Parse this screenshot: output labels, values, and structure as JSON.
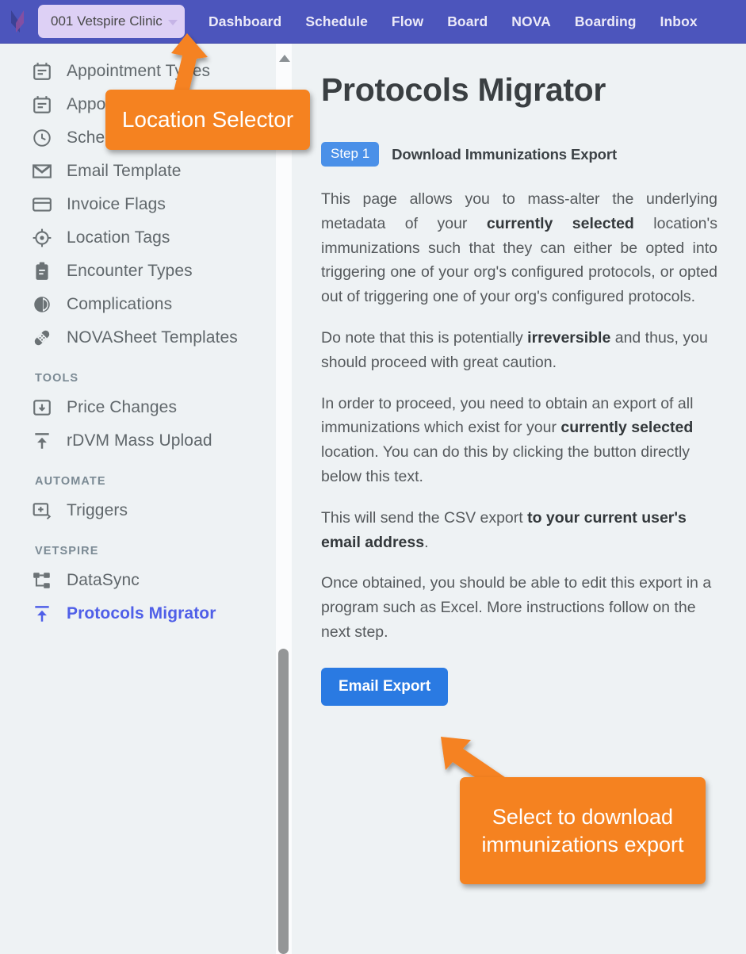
{
  "topnav": {
    "logo_icon": "vetspire-logo-icon",
    "location_selector": {
      "value": "001 Vetspire Clinic",
      "caret_icon": "chevron-down-icon"
    },
    "links": [
      {
        "label": "Dashboard"
      },
      {
        "label": "Schedule"
      },
      {
        "label": "Flow"
      },
      {
        "label": "Board"
      },
      {
        "label": "NOVA"
      },
      {
        "label": "Boarding"
      },
      {
        "label": "Inbox"
      }
    ]
  },
  "sidebar": {
    "items": [
      {
        "label": "Appointment Types",
        "icon": "calendar-icon",
        "active": false
      },
      {
        "label": "Appointment Tags",
        "icon": "calendar-icon",
        "active": false
      },
      {
        "label": "Schedule Templates",
        "icon": "clock-icon",
        "active": false
      },
      {
        "label": "Email Template",
        "icon": "envelope-icon",
        "active": false
      },
      {
        "label": "Invoice Flags",
        "icon": "credit-card-icon",
        "active": false
      },
      {
        "label": "Location Tags",
        "icon": "crosshair-icon",
        "active": false
      },
      {
        "label": "Encounter Types",
        "icon": "clipboard-icon",
        "active": false
      },
      {
        "label": "Complications",
        "icon": "pie-chart-icon",
        "active": false
      },
      {
        "label": "NOVASheet Templates",
        "icon": "bandage-icon",
        "active": false
      }
    ],
    "sections": [
      {
        "heading": "TOOLS",
        "items": [
          {
            "label": "Price Changes",
            "icon": "import-box-icon",
            "active": false
          },
          {
            "label": "rDVM Mass Upload",
            "icon": "upload-icon",
            "active": false
          }
        ]
      },
      {
        "heading": "AUTOMATE",
        "items": [
          {
            "label": "Triggers",
            "icon": "add-screen-icon",
            "active": false
          }
        ]
      },
      {
        "heading": "VETSPIRE",
        "items": [
          {
            "label": "DataSync",
            "icon": "sitemap-icon",
            "active": false
          },
          {
            "label": "Protocols Migrator",
            "icon": "upload-icon",
            "active": true
          }
        ]
      }
    ],
    "scrollbar": {
      "up_arrow_icon": "scroll-up-arrow-icon"
    }
  },
  "main": {
    "page_title": "Protocols Migrator",
    "step": {
      "badge": "Step 1",
      "title": "Download Immunizations Export"
    },
    "paragraphs": [
      {
        "id": "p1",
        "parts": [
          {
            "text": "This page allows you to mass-alter the underlying metadata of your ",
            "bold": false
          },
          {
            "text": "currently selected",
            "bold": true
          },
          {
            "text": " location's immunizations such that they can either be opted into triggering one of your org's configured protocols, or opted out of triggering one of your org's configured protocols.",
            "bold": false
          }
        ]
      },
      {
        "id": "p2",
        "parts": [
          {
            "text": "Do note that this is potentially ",
            "bold": false
          },
          {
            "text": "irreversible",
            "bold": true
          },
          {
            "text": " and thus, you should proceed with great caution.",
            "bold": false
          }
        ]
      },
      {
        "id": "p3",
        "parts": [
          {
            "text": "In order to proceed, you need to obtain an export of all immunizations which exist for your ",
            "bold": false
          },
          {
            "text": "currently selected",
            "bold": true
          },
          {
            "text": " location. You can do this by clicking the button directly below this text.",
            "bold": false
          }
        ]
      },
      {
        "id": "p4",
        "parts": [
          {
            "text": "This will send the CSV export ",
            "bold": false
          },
          {
            "text": "to your current user's email address",
            "bold": true
          },
          {
            "text": ".",
            "bold": false
          }
        ]
      },
      {
        "id": "p5",
        "parts": [
          {
            "text": "Once obtained, you should be able to edit this export in a program such as Excel. More instructions follow on the next step.",
            "bold": false
          }
        ]
      }
    ],
    "email_export_button": "Email Export"
  },
  "annotations": [
    {
      "id": "location",
      "text": "Location Selector",
      "color": "#f58220"
    },
    {
      "id": "export",
      "text": "Select to download immunizations export",
      "color": "#f58220"
    }
  ]
}
